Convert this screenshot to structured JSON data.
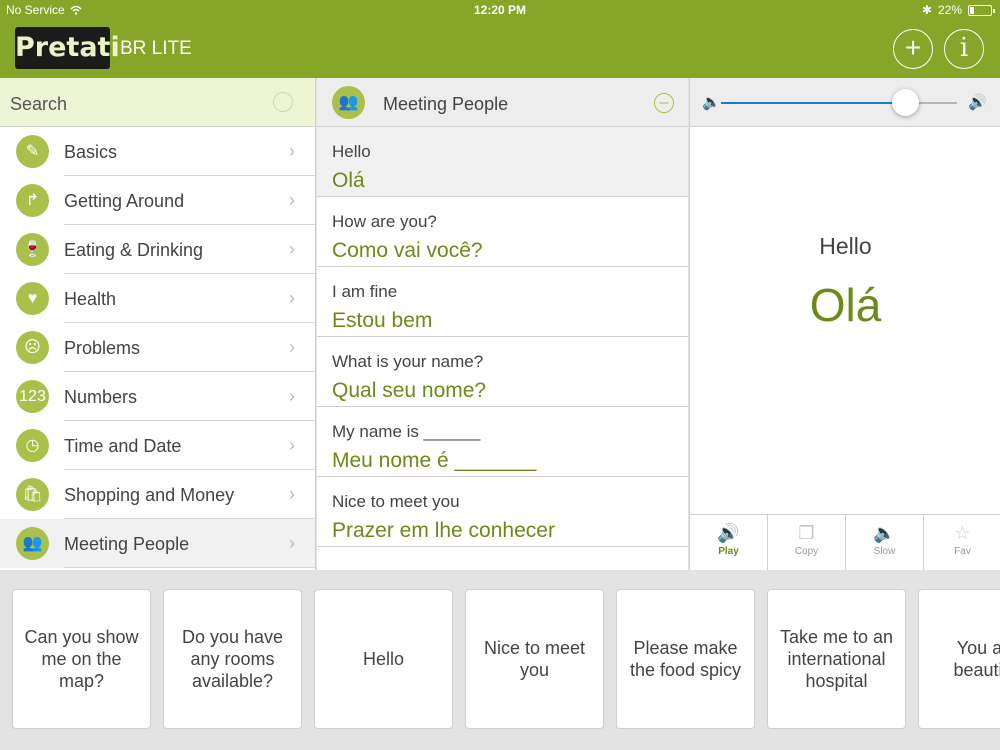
{
  "status": {
    "carrier": "No Service",
    "time": "12:20 PM",
    "battery": "22%",
    "battery_level": 0.22
  },
  "header": {
    "logo": "Pretati",
    "app_name": "BR LITE",
    "add_icon": "+",
    "info_icon": "i"
  },
  "search": {
    "placeholder": "Search"
  },
  "categories": [
    {
      "label": "Basics",
      "icon": "pencil-icon",
      "glyph": "✎"
    },
    {
      "label": "Getting Around",
      "icon": "turn-right-arrow-icon",
      "glyph": "↱"
    },
    {
      "label": "Eating & Drinking",
      "icon": "wine-glass-icon",
      "glyph": "🍷"
    },
    {
      "label": "Health",
      "icon": "stethoscope-icon",
      "glyph": "♥"
    },
    {
      "label": "Problems",
      "icon": "sad-face-icon",
      "glyph": "☹"
    },
    {
      "label": "Numbers",
      "icon": "numbers-icon",
      "glyph": "123"
    },
    {
      "label": "Time and Date",
      "icon": "clock-calendar-icon",
      "glyph": "◷"
    },
    {
      "label": "Shopping and Money",
      "icon": "shopping-bag-icon",
      "glyph": "🛍"
    },
    {
      "label": "Meeting People",
      "icon": "people-icon",
      "glyph": "👥"
    }
  ],
  "chevron": "›",
  "phrase_list": {
    "title": "Meeting People",
    "collapse_icon": "–",
    "items": [
      {
        "en": "Hello",
        "pt": "Olá"
      },
      {
        "en": "How are you?",
        "pt": "Como vai você?"
      },
      {
        "en": "I am fine",
        "pt": "Estou bem"
      },
      {
        "en": "What is your name?",
        "pt": "Qual seu nome?"
      },
      {
        "en": "My name is ______",
        "pt": "Meu nome é _______"
      },
      {
        "en": "Nice to meet you",
        "pt": "Prazer em lhe conhecer"
      }
    ]
  },
  "detail": {
    "volume": 0.78,
    "en": "Hello",
    "pt": "Olá",
    "actions": [
      {
        "label": "Play",
        "icon": "speaker-icon",
        "glyph": "🔊"
      },
      {
        "label": "Copy",
        "icon": "copy-icon",
        "glyph": "❐"
      },
      {
        "label": "Slow",
        "icon": "speaker-slow-icon",
        "glyph": "🔈"
      },
      {
        "label": "Fav",
        "icon": "star-icon",
        "glyph": "☆"
      }
    ]
  },
  "quick_phrases": [
    "Can you show me on the map?",
    "Do you have any rooms available?",
    "Hello",
    "Nice to meet you",
    "Please make the food spicy",
    "Take me to an international hospital",
    "You are beautiful"
  ],
  "colors": {
    "brand_green": "#86a629",
    "text_green": "#6c8a17",
    "slider_blue": "#1a7bd6"
  }
}
